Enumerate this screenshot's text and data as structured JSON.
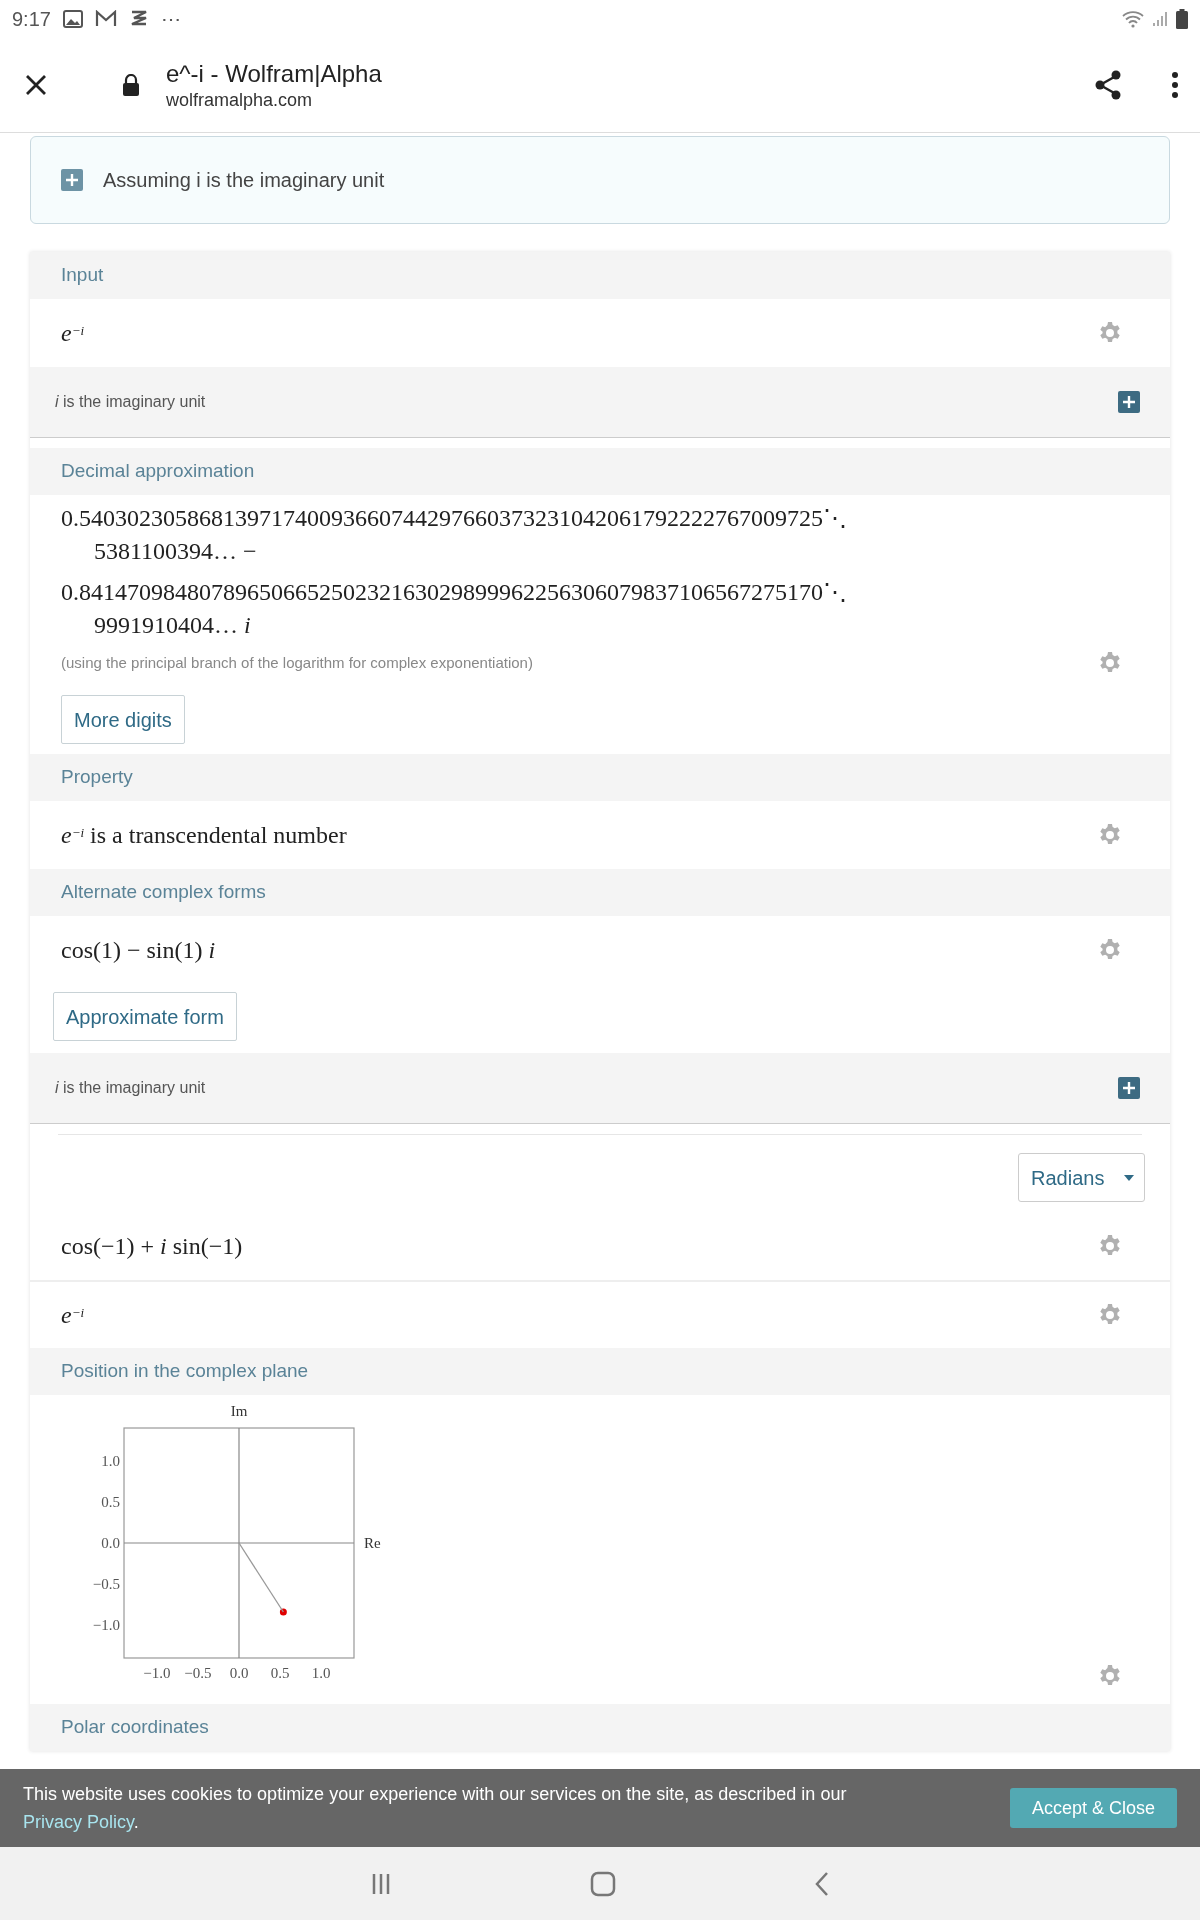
{
  "status_bar": {
    "time": "9:17",
    "more": "⋯"
  },
  "browser": {
    "title": "e^-i - Wolfram|Alpha",
    "url": "wolframalpha.com"
  },
  "assumption": {
    "text": "Assuming i is the imaginary unit"
  },
  "sections": [
    {
      "kind": "pod",
      "title": "Input",
      "rows": [
        {
          "kind": "math",
          "text": "*e*$^{−i}$"
        }
      ]
    },
    {
      "kind": "note",
      "text": "*i* is the imaginary unit"
    },
    {
      "kind": "pod",
      "title": "Decimal approximation",
      "rows": [
        {
          "kind": "line",
          "text": "0.54030230586813971740093660744297660373231042061792222767009725⋱"
        },
        {
          "kind": "indent",
          "text": "5381100394… −"
        },
        {
          "kind": "line",
          "text": "0.84147098480789650665250232163029899962256306079837106567275170⋱"
        },
        {
          "kind": "indent",
          "text": "9991910404… *i*"
        },
        {
          "kind": "remark",
          "text": "(using the principal branch of the logarithm for complex exponentiation)"
        },
        {
          "kind": "button",
          "text": "More digits"
        }
      ]
    },
    {
      "kind": "pod",
      "title": "Property",
      "rows": [
        {
          "kind": "math",
          "text": "*e*$^{−i}$ is a transcendental number"
        }
      ]
    },
    {
      "kind": "pod",
      "title": "Alternate complex forms",
      "rows": [
        {
          "kind": "math",
          "text": "cos(1) − sin(1) *i*"
        },
        {
          "kind": "button",
          "text": "Approximate form"
        }
      ]
    },
    {
      "kind": "note",
      "text": "*i* is the imaginary unit"
    },
    {
      "kind": "pod",
      "rows": [
        {
          "kind": "dropdown",
          "text": "Radians"
        },
        {
          "kind": "math",
          "text": "cos(−1) + *i* sin(−1)"
        },
        {
          "kind": "math",
          "text": "*e*$^{−i}$"
        }
      ]
    },
    {
      "kind": "pod",
      "title": "Position in the complex plane",
      "rows": [
        {
          "kind": "chart",
          "chart_data": {
            "type": "scatter",
            "xlabel": "Re",
            "ylabel": "Im",
            "x": [
              0.54
            ],
            "values": [
              -0.84
            ],
            "xlim": [
              -1.4,
              1.4
            ],
            "ylim": [
              -1.4,
              1.4
            ],
            "xticks": [
              {
                "value": -1,
                "label": "−1.0"
              },
              {
                "value": -0.5,
                "label": "−0.5"
              },
              {
                "value": 0,
                "label": "0.0"
              },
              {
                "value": 0.5,
                "label": "0.5"
              },
              {
                "value": 1,
                "label": "1.0"
              }
            ],
            "yticks": [
              {
                "value": -1,
                "label": "−1.0"
              },
              {
                "value": -0.5,
                "label": "−0.5"
              },
              {
                "value": 0,
                "label": "0.0"
              },
              {
                "value": 0.5,
                "label": "0.5"
              },
              {
                "value": 1,
                "label": "1.0"
              }
            ]
          }
        }
      ]
    },
    {
      "kind": "pod",
      "title": "Polar coordinates"
    }
  ],
  "cookie": {
    "text": "This website uses cookies to optimize your experience with our services on the site, as described in our",
    "link": "Privacy Policy",
    "after": ".",
    "button": "Accept & Close"
  }
}
